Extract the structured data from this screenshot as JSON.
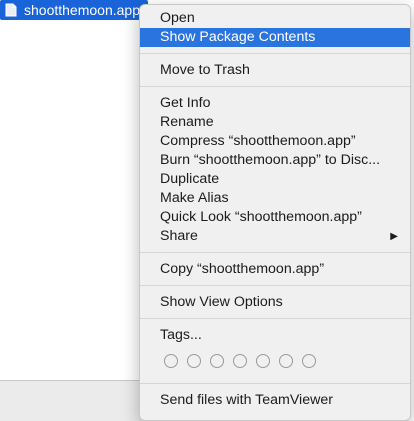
{
  "file": {
    "name": "shootthemoon.app",
    "icon": "app-file-icon"
  },
  "menu": {
    "group1": [
      {
        "label": "Open"
      },
      {
        "label": "Show Package Contents",
        "highlighted": true
      }
    ],
    "group2": [
      {
        "label": "Move to Trash"
      }
    ],
    "group3": [
      {
        "label": "Get Info"
      },
      {
        "label": "Rename"
      },
      {
        "label": "Compress “shootthemoon.app”"
      },
      {
        "label": "Burn “shootthemoon.app” to Disc..."
      },
      {
        "label": "Duplicate"
      },
      {
        "label": "Make Alias"
      },
      {
        "label": "Quick Look “shootthemoon.app”"
      },
      {
        "label": "Share",
        "submenu_icon": "triangle-right-icon"
      }
    ],
    "group4": [
      {
        "label": "Copy “shootthemoon.app”"
      }
    ],
    "group5": [
      {
        "label": "Show View Options"
      }
    ],
    "group6": {
      "tags_label": "Tags...",
      "tag_count": 7
    },
    "group7": [
      {
        "label": "Send files with TeamViewer"
      }
    ]
  },
  "colors": {
    "selection": "#1a64d9",
    "menu_highlight": "#2a74e0",
    "menu_bg": "#f0f0f0"
  }
}
